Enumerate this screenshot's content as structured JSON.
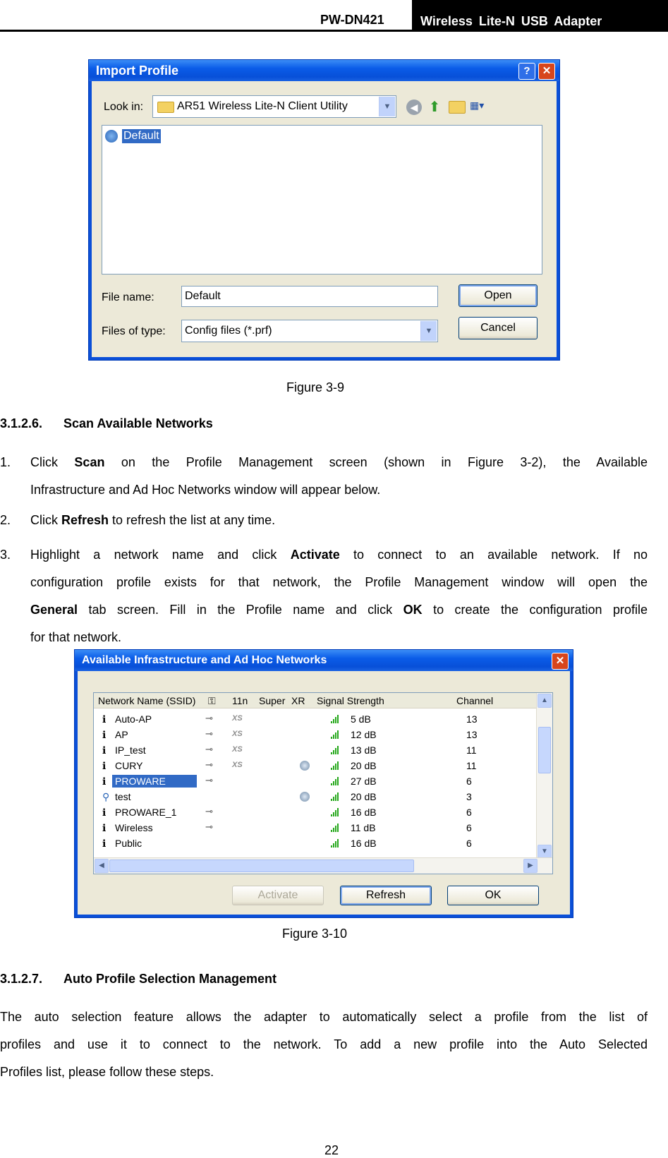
{
  "header": {
    "model": "PW-DN421",
    "product": "Wireless  Lite-N  USB  Adapter"
  },
  "import_dialog": {
    "title": "Import Profile",
    "help_label": "?",
    "close_label": "✕",
    "look_in_label": "Look in:",
    "look_in_value": "AR51 Wireless Lite-N Client Utility",
    "files": [
      "Default"
    ],
    "file_name_label": "File name:",
    "file_name_value": "Default",
    "file_type_label": "Files of type:",
    "file_type_value": "Config files (*.prf)",
    "open_label": "Open",
    "cancel_label": "Cancel"
  },
  "figure_1": "Figure 3-9",
  "section_1": {
    "number": "3.1.2.6.",
    "title": "Scan Available Networks"
  },
  "steps": [
    {
      "n": "1.",
      "a": "Click ",
      "b": "Scan",
      "c": " on the Profile Management screen (shown in Figure 3-2), the Available",
      "d": "Infrastructure and Ad Hoc Networks window will appear below."
    },
    {
      "n": "2.",
      "a": "Click ",
      "b": "Refresh",
      "c": " to refresh the list at any time."
    },
    {
      "n": "3.",
      "a": "Highlight a network name and click ",
      "b": "Activate",
      "c": " to connect to an available network. If no",
      "d": "configuration profile exists for that network, the Profile Management window will open the",
      "e": "General",
      "f": " tab screen. Fill in the Profile name and click ",
      "g": "OK",
      "h": " to create the configuration profile",
      "i": "for that network."
    }
  ],
  "networks_dialog": {
    "title": "Available Infrastructure and Ad Hoc Networks",
    "close_label": "✕",
    "columns": [
      "Network Name (SSID)",
      "",
      "11n",
      "Super",
      "XR",
      "Signal Strength",
      "Channel"
    ],
    "rows": [
      {
        "ssid": "Auto-AP",
        "key": true,
        "xs": true,
        "xr": false,
        "signal": "5 dB",
        "channel": "13",
        "adhoc": false,
        "selected": false
      },
      {
        "ssid": "AP",
        "key": true,
        "xs": true,
        "xr": false,
        "signal": "12 dB",
        "channel": "13",
        "adhoc": false,
        "selected": false
      },
      {
        "ssid": "IP_test",
        "key": true,
        "xs": true,
        "xr": false,
        "signal": "13 dB",
        "channel": "11",
        "adhoc": false,
        "selected": false
      },
      {
        "ssid": "CURY",
        "key": true,
        "xs": true,
        "xr": true,
        "signal": "20 dB",
        "channel": "11",
        "adhoc": false,
        "selected": false
      },
      {
        "ssid": "PROWARE",
        "key": true,
        "xs": false,
        "xr": false,
        "signal": "27 dB",
        "channel": "6",
        "adhoc": false,
        "selected": true
      },
      {
        "ssid": "test",
        "key": false,
        "xs": false,
        "xr": true,
        "signal": "20 dB",
        "channel": "3",
        "adhoc": true,
        "selected": false
      },
      {
        "ssid": "PROWARE_1",
        "key": true,
        "xs": false,
        "xr": false,
        "signal": "16 dB",
        "channel": "6",
        "adhoc": false,
        "selected": false
      },
      {
        "ssid": "Wireless",
        "key": true,
        "xs": false,
        "xr": false,
        "signal": "11 dB",
        "channel": "6",
        "adhoc": false,
        "selected": false
      },
      {
        "ssid": "Public",
        "key": false,
        "xs": false,
        "xr": false,
        "signal": "16 dB",
        "channel": "6",
        "adhoc": false,
        "selected": false
      }
    ],
    "activate_label": "Activate",
    "refresh_label": "Refresh",
    "ok_label": "OK"
  },
  "figure_2": "Figure 3-10",
  "section_2": {
    "number": "3.1.2.7.",
    "title": "Auto Profile Selection Management"
  },
  "body": {
    "line1": "The auto selection feature allows the adapter to automatically select a profile from the list of",
    "line2": "profiles and use it to connect to the network. To add a new profile into the Auto Selected",
    "line3": "Profiles list, please follow these steps."
  },
  "page_number": "22",
  "colors": {
    "xp_title": "#0a5ce8",
    "selection": "#316ac5",
    "signal_bars": "#26a81c",
    "dialog_face": "#ece9d8"
  },
  "icons": [
    "help-icon",
    "close-icon",
    "folder-icon",
    "back-icon",
    "up-folder-icon",
    "new-folder-icon",
    "view-menu-icon",
    "profile-icon",
    "infrastructure-icon",
    "adhoc-icon",
    "key-icon",
    "xs-icon",
    "xr-icon",
    "signal-icon"
  ]
}
